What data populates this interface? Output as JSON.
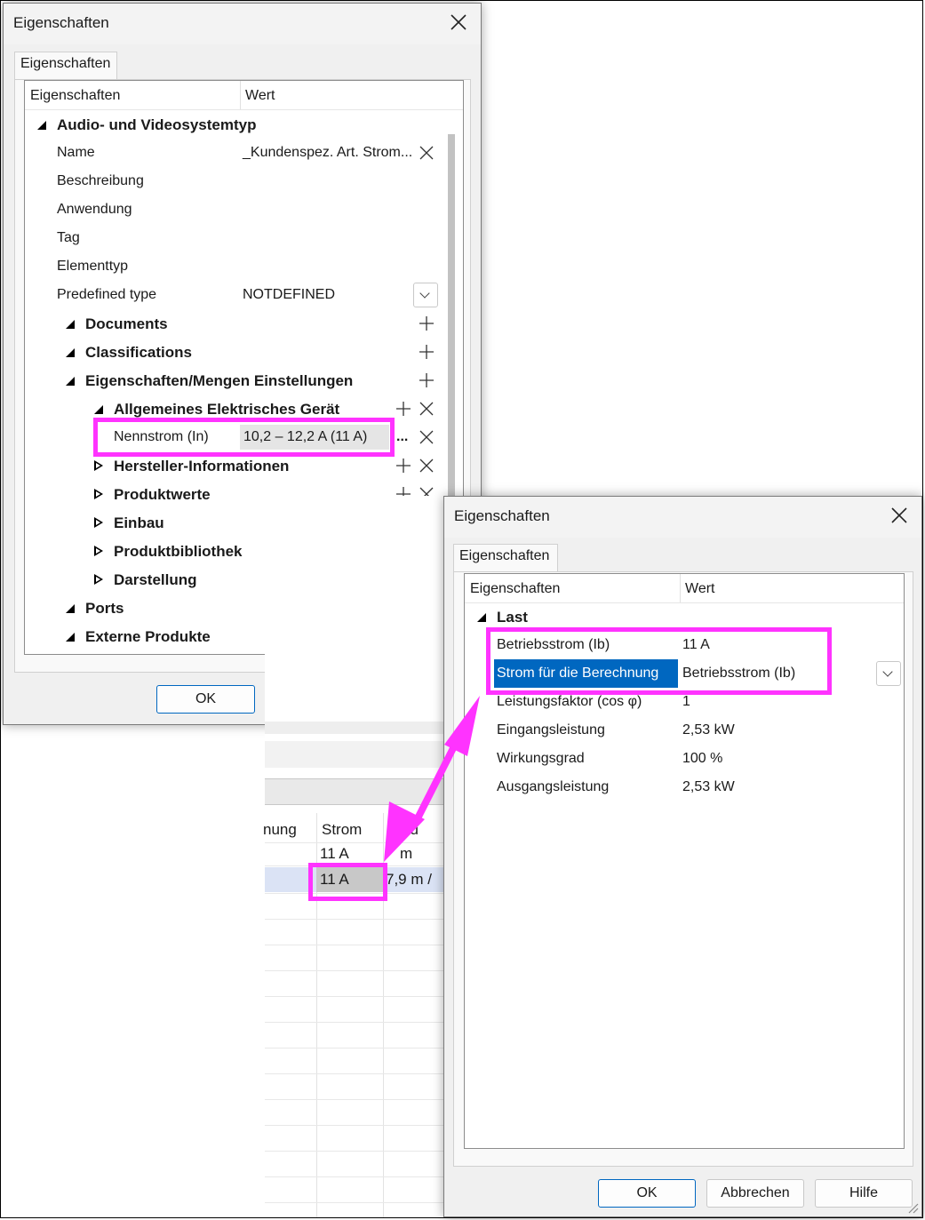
{
  "dialog1": {
    "title": "Eigenschaften",
    "tab": "Eigenschaften",
    "col_property": "Eigenschaften",
    "col_value": "Wert",
    "group_main": "Audio- und Videosystemtyp",
    "name_label": "Name",
    "name_value": "_Kundenspez. Art. Strom...",
    "description_label": "Beschreibung",
    "application_label": "Anwendung",
    "tag_label": "Tag",
    "elementtype_label": "Elementtyp",
    "predefined_label": "Predefined type",
    "predefined_value": "NOTDEFINED",
    "documents": "Documents",
    "classifications": "Classifications",
    "settings": "Eigenschaften/Mengen Einstellungen",
    "general_device": "Allgemeines Elektrisches Gerät",
    "rated_current_label": "Nennstrom (In)",
    "rated_current_value": "10,2 – 12,2 A (11 A)",
    "ellipsis": "...",
    "manufacturer_info": "Hersteller-Informationen",
    "product_values": "Produktwerte",
    "installation": "Einbau",
    "product_library": "Produktbibliothek",
    "display": "Darstellung",
    "ports": "Ports",
    "external_products": "Externe Produkte",
    "ok": "OK"
  },
  "sheet": {
    "col_partial": "nung",
    "col_current": "Strom",
    "col_partial2": "S    nu",
    "row1_current": "11 A",
    "row1_partial": "m",
    "row2_current": "11 A",
    "row2_partial": "7,9 m /"
  },
  "dialog2": {
    "title": "Eigenschaften",
    "tab": "Eigenschaften",
    "col_property": "Eigenschaften",
    "col_value": "Wert",
    "group_load": "Last",
    "operating_current_label": "Betriebsstrom (Ib)",
    "operating_current_value": "11 A",
    "calc_current_label": "Strom für die Berechnung",
    "calc_current_value": "Betriebsstrom (Ib)",
    "power_factor_label": "Leistungsfaktor (cos φ)",
    "power_factor_value": "1",
    "input_power_label": "Eingangsleistung",
    "input_power_value": "2,53 kW",
    "efficiency_label": "Wirkungsgrad",
    "efficiency_value": "100 %",
    "output_power_label": "Ausgangsleistung",
    "output_power_value": "2,53 kW",
    "ok": "OK",
    "cancel": "Abbrechen",
    "help": "Hilfe"
  },
  "colors": {
    "highlight": "#ff33ff",
    "selection": "#0067c0",
    "selected_row": "#dbe3f5"
  },
  "icons": [
    "close-icon",
    "plus-icon",
    "delete-icon",
    "chevron-down-icon",
    "expand-triangle-icon",
    "collapse-triangle-icon",
    "arrow-annotation"
  ]
}
